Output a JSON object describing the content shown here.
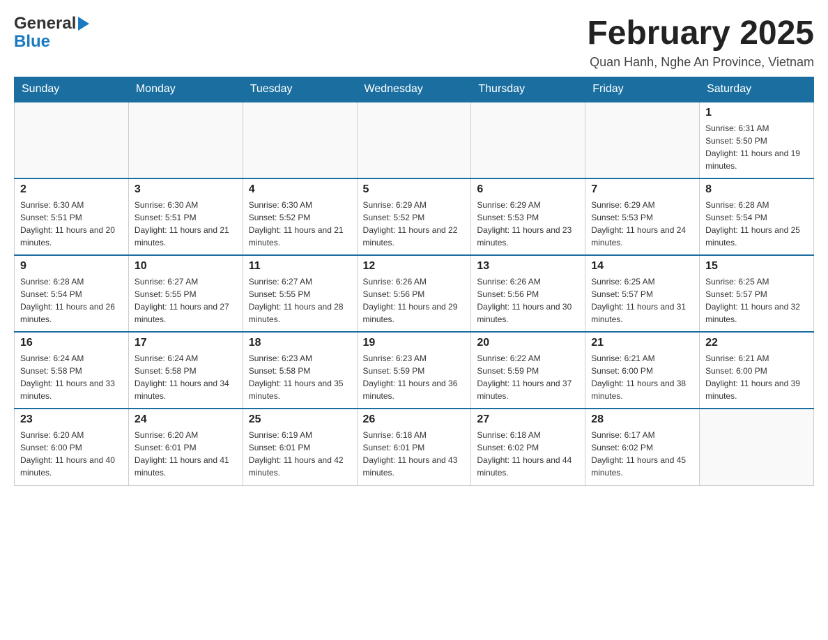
{
  "logo": {
    "text_general": "General",
    "arrow_color": "#1a7abf",
    "text_blue": "Blue"
  },
  "header": {
    "month_title": "February 2025",
    "location": "Quan Hanh, Nghe An Province, Vietnam"
  },
  "weekdays": [
    "Sunday",
    "Monday",
    "Tuesday",
    "Wednesday",
    "Thursday",
    "Friday",
    "Saturday"
  ],
  "weeks": [
    {
      "days": [
        {
          "num": "",
          "sunrise": "",
          "sunset": "",
          "daylight": ""
        },
        {
          "num": "",
          "sunrise": "",
          "sunset": "",
          "daylight": ""
        },
        {
          "num": "",
          "sunrise": "",
          "sunset": "",
          "daylight": ""
        },
        {
          "num": "",
          "sunrise": "",
          "sunset": "",
          "daylight": ""
        },
        {
          "num": "",
          "sunrise": "",
          "sunset": "",
          "daylight": ""
        },
        {
          "num": "",
          "sunrise": "",
          "sunset": "",
          "daylight": ""
        },
        {
          "num": "1",
          "sunrise": "Sunrise: 6:31 AM",
          "sunset": "Sunset: 5:50 PM",
          "daylight": "Daylight: 11 hours and 19 minutes."
        }
      ]
    },
    {
      "days": [
        {
          "num": "2",
          "sunrise": "Sunrise: 6:30 AM",
          "sunset": "Sunset: 5:51 PM",
          "daylight": "Daylight: 11 hours and 20 minutes."
        },
        {
          "num": "3",
          "sunrise": "Sunrise: 6:30 AM",
          "sunset": "Sunset: 5:51 PM",
          "daylight": "Daylight: 11 hours and 21 minutes."
        },
        {
          "num": "4",
          "sunrise": "Sunrise: 6:30 AM",
          "sunset": "Sunset: 5:52 PM",
          "daylight": "Daylight: 11 hours and 21 minutes."
        },
        {
          "num": "5",
          "sunrise": "Sunrise: 6:29 AM",
          "sunset": "Sunset: 5:52 PM",
          "daylight": "Daylight: 11 hours and 22 minutes."
        },
        {
          "num": "6",
          "sunrise": "Sunrise: 6:29 AM",
          "sunset": "Sunset: 5:53 PM",
          "daylight": "Daylight: 11 hours and 23 minutes."
        },
        {
          "num": "7",
          "sunrise": "Sunrise: 6:29 AM",
          "sunset": "Sunset: 5:53 PM",
          "daylight": "Daylight: 11 hours and 24 minutes."
        },
        {
          "num": "8",
          "sunrise": "Sunrise: 6:28 AM",
          "sunset": "Sunset: 5:54 PM",
          "daylight": "Daylight: 11 hours and 25 minutes."
        }
      ]
    },
    {
      "days": [
        {
          "num": "9",
          "sunrise": "Sunrise: 6:28 AM",
          "sunset": "Sunset: 5:54 PM",
          "daylight": "Daylight: 11 hours and 26 minutes."
        },
        {
          "num": "10",
          "sunrise": "Sunrise: 6:27 AM",
          "sunset": "Sunset: 5:55 PM",
          "daylight": "Daylight: 11 hours and 27 minutes."
        },
        {
          "num": "11",
          "sunrise": "Sunrise: 6:27 AM",
          "sunset": "Sunset: 5:55 PM",
          "daylight": "Daylight: 11 hours and 28 minutes."
        },
        {
          "num": "12",
          "sunrise": "Sunrise: 6:26 AM",
          "sunset": "Sunset: 5:56 PM",
          "daylight": "Daylight: 11 hours and 29 minutes."
        },
        {
          "num": "13",
          "sunrise": "Sunrise: 6:26 AM",
          "sunset": "Sunset: 5:56 PM",
          "daylight": "Daylight: 11 hours and 30 minutes."
        },
        {
          "num": "14",
          "sunrise": "Sunrise: 6:25 AM",
          "sunset": "Sunset: 5:57 PM",
          "daylight": "Daylight: 11 hours and 31 minutes."
        },
        {
          "num": "15",
          "sunrise": "Sunrise: 6:25 AM",
          "sunset": "Sunset: 5:57 PM",
          "daylight": "Daylight: 11 hours and 32 minutes."
        }
      ]
    },
    {
      "days": [
        {
          "num": "16",
          "sunrise": "Sunrise: 6:24 AM",
          "sunset": "Sunset: 5:58 PM",
          "daylight": "Daylight: 11 hours and 33 minutes."
        },
        {
          "num": "17",
          "sunrise": "Sunrise: 6:24 AM",
          "sunset": "Sunset: 5:58 PM",
          "daylight": "Daylight: 11 hours and 34 minutes."
        },
        {
          "num": "18",
          "sunrise": "Sunrise: 6:23 AM",
          "sunset": "Sunset: 5:58 PM",
          "daylight": "Daylight: 11 hours and 35 minutes."
        },
        {
          "num": "19",
          "sunrise": "Sunrise: 6:23 AM",
          "sunset": "Sunset: 5:59 PM",
          "daylight": "Daylight: 11 hours and 36 minutes."
        },
        {
          "num": "20",
          "sunrise": "Sunrise: 6:22 AM",
          "sunset": "Sunset: 5:59 PM",
          "daylight": "Daylight: 11 hours and 37 minutes."
        },
        {
          "num": "21",
          "sunrise": "Sunrise: 6:21 AM",
          "sunset": "Sunset: 6:00 PM",
          "daylight": "Daylight: 11 hours and 38 minutes."
        },
        {
          "num": "22",
          "sunrise": "Sunrise: 6:21 AM",
          "sunset": "Sunset: 6:00 PM",
          "daylight": "Daylight: 11 hours and 39 minutes."
        }
      ]
    },
    {
      "days": [
        {
          "num": "23",
          "sunrise": "Sunrise: 6:20 AM",
          "sunset": "Sunset: 6:00 PM",
          "daylight": "Daylight: 11 hours and 40 minutes."
        },
        {
          "num": "24",
          "sunrise": "Sunrise: 6:20 AM",
          "sunset": "Sunset: 6:01 PM",
          "daylight": "Daylight: 11 hours and 41 minutes."
        },
        {
          "num": "25",
          "sunrise": "Sunrise: 6:19 AM",
          "sunset": "Sunset: 6:01 PM",
          "daylight": "Daylight: 11 hours and 42 minutes."
        },
        {
          "num": "26",
          "sunrise": "Sunrise: 6:18 AM",
          "sunset": "Sunset: 6:01 PM",
          "daylight": "Daylight: 11 hours and 43 minutes."
        },
        {
          "num": "27",
          "sunrise": "Sunrise: 6:18 AM",
          "sunset": "Sunset: 6:02 PM",
          "daylight": "Daylight: 11 hours and 44 minutes."
        },
        {
          "num": "28",
          "sunrise": "Sunrise: 6:17 AM",
          "sunset": "Sunset: 6:02 PM",
          "daylight": "Daylight: 11 hours and 45 minutes."
        },
        {
          "num": "",
          "sunrise": "",
          "sunset": "",
          "daylight": ""
        }
      ]
    }
  ]
}
